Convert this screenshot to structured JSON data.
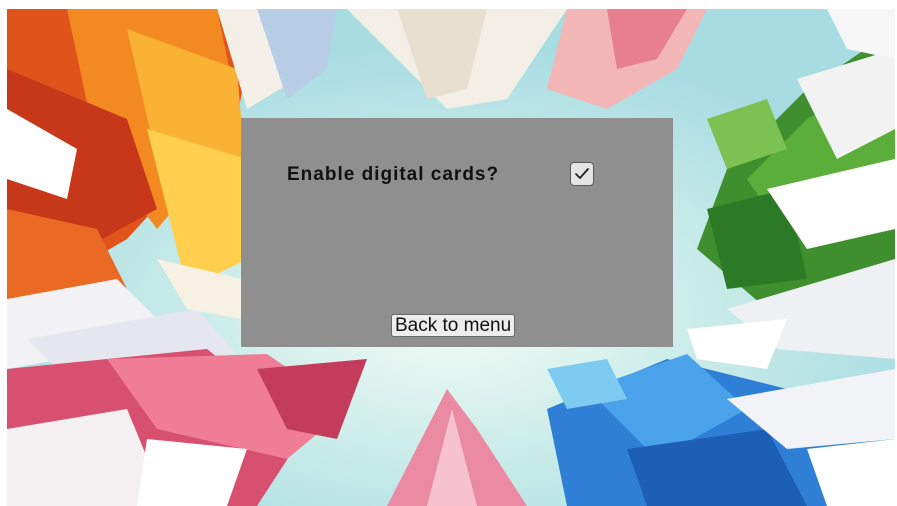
{
  "settings_panel": {
    "option_label": "Enable digital cards?",
    "option_checked": true,
    "back_button_label": "Back to menu"
  },
  "icons": {
    "checkbox_mark": "checkmark-icon"
  },
  "colors": {
    "panel_background": "#8f8f8f",
    "fire": "#f08a1e",
    "nature": "#3f8f2e",
    "water": "#2f7fd6",
    "crystal": "#e86a86",
    "sky": "#bfe6e9"
  }
}
